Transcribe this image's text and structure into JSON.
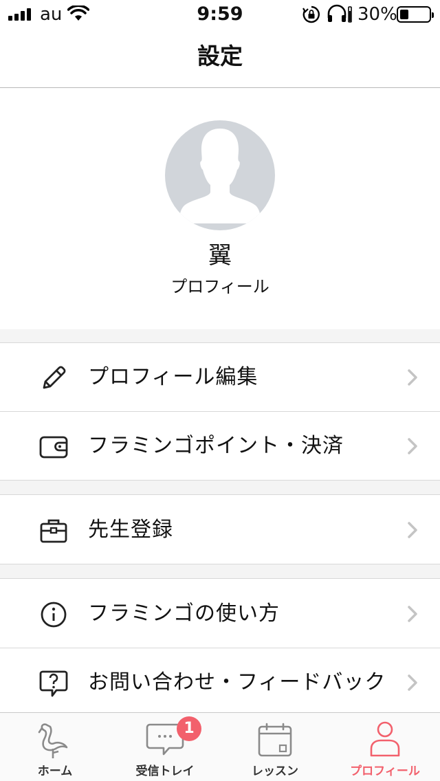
{
  "status_bar": {
    "carrier": "au",
    "time": "9:59",
    "battery_percent": "30%",
    "battery_level": 0.3
  },
  "header": {
    "title": "設定"
  },
  "profile": {
    "name": "翼",
    "subtitle": "プロフィール"
  },
  "menu": {
    "edit_profile": "プロフィール編集",
    "points_payment": "フラミンゴポイント・決済",
    "teacher_registration": "先生登録",
    "how_to_use": "フラミンゴの使い方",
    "contact_feedback": "お問い合わせ・フィードバック"
  },
  "tabbar": {
    "tabs": [
      {
        "label": "ホーム",
        "icon": "flamingo-icon"
      },
      {
        "label": "受信トレイ",
        "icon": "chat-bubble-icon"
      },
      {
        "label": "レッスン",
        "icon": "calendar-icon"
      },
      {
        "label": "プロフィール",
        "icon": "person-icon"
      }
    ],
    "inbox_badge": "1",
    "active_color": "#f2606c"
  }
}
